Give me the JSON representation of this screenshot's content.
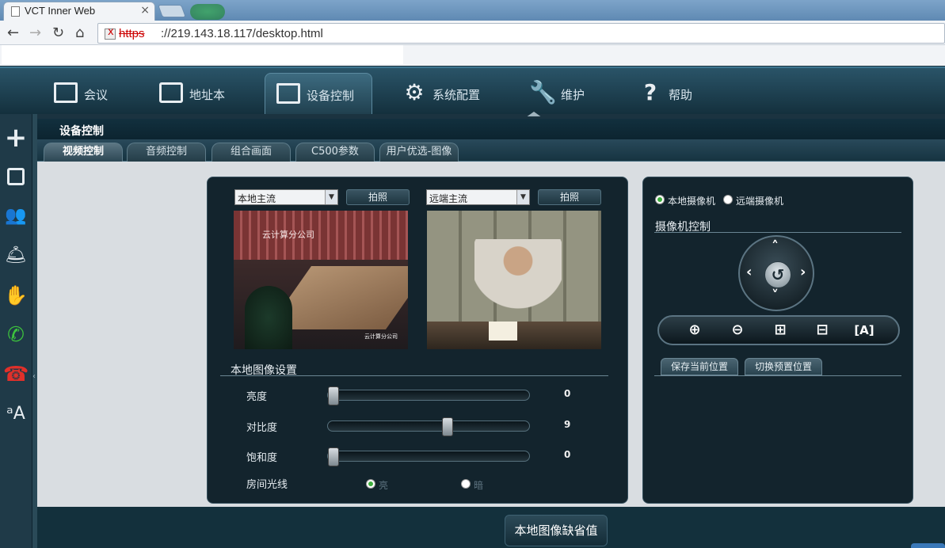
{
  "browser": {
    "tab_title": "VCT Inner Web",
    "tab_close": "×",
    "url_scheme": "https",
    "url_rest": "://219.143.18.117/desktop.html",
    "url_error_mark": "x"
  },
  "nav": {
    "items": [
      {
        "label": "会议",
        "icon": "meeting-icon"
      },
      {
        "label": "地址本",
        "icon": "address-book-icon"
      },
      {
        "label": "设备控制",
        "icon": "monitor-icon"
      },
      {
        "label": "系统配置",
        "icon": "gear-icon"
      },
      {
        "label": "维护",
        "icon": "wrench-icon"
      },
      {
        "label": "帮助",
        "icon": "help-icon"
      }
    ],
    "active": "设备控制"
  },
  "section": {
    "title": "设备控制",
    "tabs": [
      "视频控制",
      "音频控制",
      "组合画面",
      "C500参数",
      "用户优选-图像"
    ],
    "active_tab": "视频控制"
  },
  "video": {
    "local_stream": "本地主流",
    "remote_stream": "远端主流",
    "snapshot": "拍照",
    "local_caption": "云计算分公司",
    "local_caption_small": "云计算分公司"
  },
  "image_settings": {
    "title": "本地图像设置",
    "brightness_label": "亮度",
    "brightness_value": "0",
    "brightness_level": 0,
    "contrast_label": "对比度",
    "contrast_value": "9",
    "contrast_level": 0.6,
    "saturation_label": "饱和度",
    "saturation_value": "0",
    "saturation_level": 0,
    "room_light_label": "房间光线",
    "light_bright": "亮",
    "light_dark": "暗",
    "room_light_selected": "亮"
  },
  "camera": {
    "local_camera": "本地摄像机",
    "remote_camera": "远端摄像机",
    "selected": "本地摄像机",
    "control_title": "摄像机控制",
    "save_position": "保存当前位置",
    "switch_preset": "切换预置位置"
  },
  "bottom": {
    "default_button": "本地图像缺省值"
  },
  "colors": {
    "accent_green": "#3dae3d",
    "header_bg": "#14303d",
    "content_bg": "#d9dde1",
    "panel_bg": "#13242d"
  }
}
